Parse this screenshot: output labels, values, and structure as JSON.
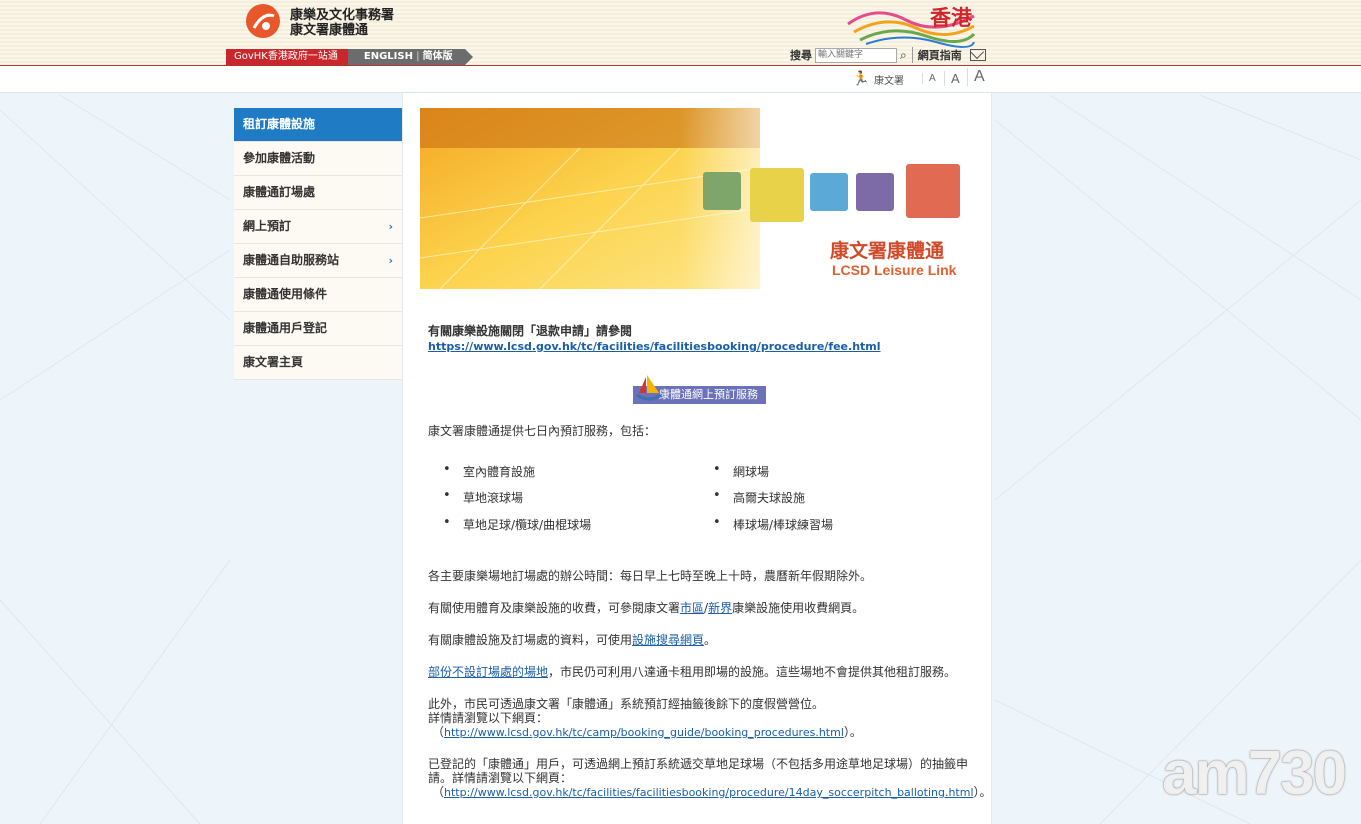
{
  "header": {
    "org_line1": "康樂及文化事務署",
    "org_line2": "康文署康體通",
    "govhk": "GovHK香港政府一站通",
    "lang_english": "ENGLISH",
    "lang_simplified": "简体版",
    "hk_brand_text": "香港",
    "search_label": "搜尋",
    "search_placeholder": "輸入關鍵字",
    "sitemap": "網頁指南"
  },
  "subbar": {
    "lcsd": "康文署",
    "font_small": "A",
    "font_medium": "A",
    "font_large": "A"
  },
  "sidebar": {
    "items": [
      {
        "label": "租訂康體設施"
      },
      {
        "label": "參加康體活動"
      },
      {
        "label": "康體通訂場處"
      },
      {
        "label": "網上預訂",
        "arrow": "›"
      },
      {
        "label": "康體通自助服務站",
        "arrow": "›"
      },
      {
        "label": "康體通使用條件"
      },
      {
        "label": "康體通用戶登記"
      },
      {
        "label": "康文署主頁"
      }
    ]
  },
  "banner": {
    "title": "康文署康體通",
    "subtitle": "LCSD Leisure Link"
  },
  "content": {
    "notice_title": "有關康樂設施關閉「退款申請」請參閱",
    "notice_link": "https://www.lcsd.gov.hk/tc/facilities/facilitiesbooking/procedure/fee.html",
    "booking_button": "康體通網上預訂服務",
    "intro": "康文署康體通提供七日內預訂服務，包括：",
    "facilities_left": [
      "室內體育設施",
      "草地滾球場",
      "草地足球/欖球/曲棍球場"
    ],
    "facilities_right": [
      "網球場",
      "高爾夫球設施",
      "棒球場/棒球練習場"
    ],
    "hours": "各主要康樂場地訂場處的辦公時間：每日早上七時至晚上十時，農曆新年假期除外。",
    "fee_prefix": "有關使用體育及康樂設施的收費，可參閱康文署",
    "fee_link1": "市區",
    "fee_slash": "/",
    "fee_link2": "新界",
    "fee_suffix": "康樂設施使用收費網頁。",
    "search_prefix": "有關康體設施及訂場處的資料，可使用",
    "search_link": "設施搜尋網頁",
    "search_suffix": "。",
    "nobook_link": "部份不設訂場處的場地",
    "nobook_suffix": "，市民仍可利用八達通卡租用即場的設施。這些場地不會提供其他租訂服務。",
    "camp_line1": "此外，市民可透過康文署「康體通」系統預訂經抽籤後餘下的度假營營位。",
    "camp_line2": "詳情請瀏覽以下網頁：",
    "camp_open": "（",
    "camp_link": "http://www.lcsd.gov.hk/tc/camp/booking_guide/booking_procedures.html",
    "camp_close": "）。",
    "soccer_line1": "已登記的「康體通」用戶，可透過網上預訂系統遞交草地足球場（不包括多用途草地足球場）的抽籤申",
    "soccer_line2": "請。詳情請瀏覽以下網頁：",
    "soccer_open": "（",
    "soccer_link": "http://www.lcsd.gov.hk/tc/facilities/facilitiesbooking/procedure/14day_soccerpitch_balloting.html",
    "soccer_close": "）。"
  },
  "watermark": "am730"
}
